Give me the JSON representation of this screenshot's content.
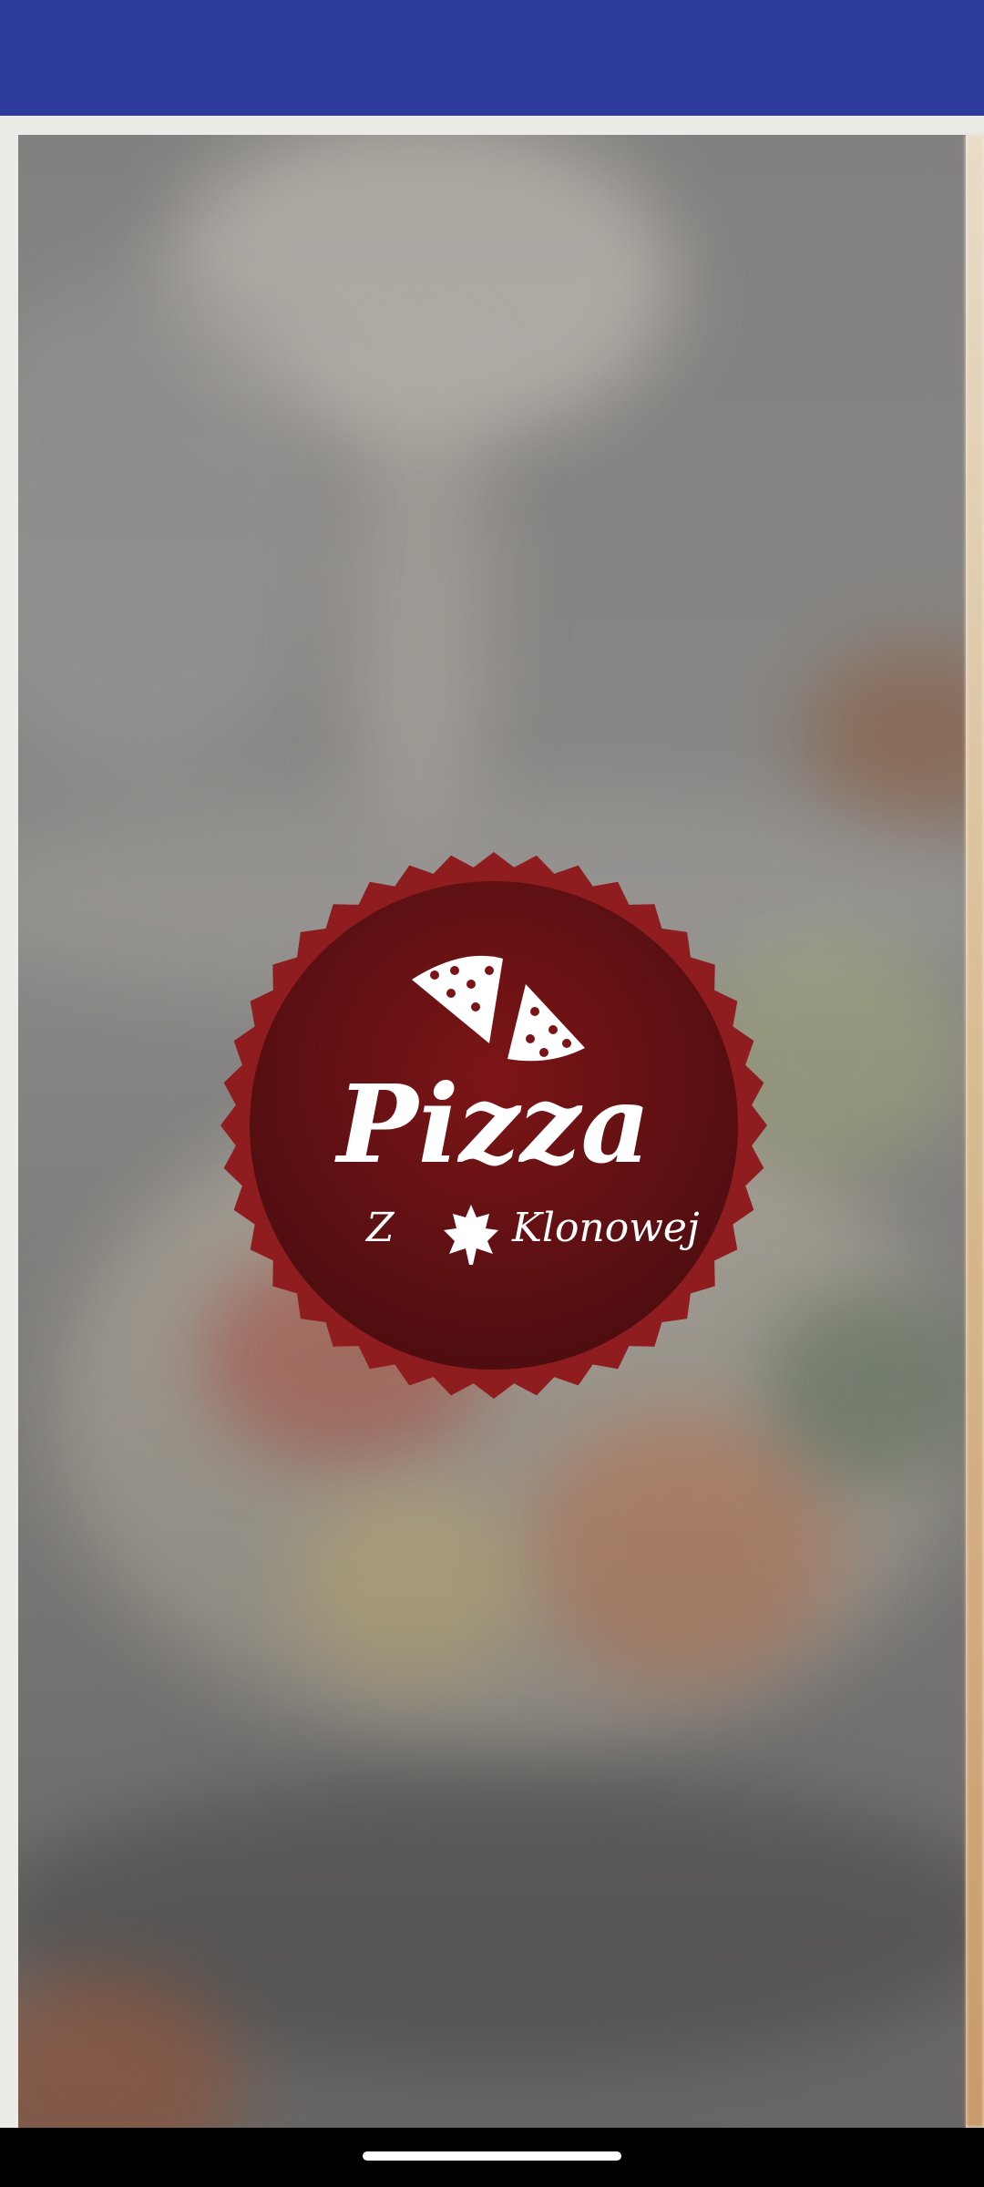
{
  "logo": {
    "title": "Pizza",
    "prefix": "Z",
    "suffix": "Klonowej",
    "leaf_icon": "maple-leaf-icon",
    "pizza_icon": "pizza-slices-icon",
    "badge_color": "#7a1417",
    "badge_edge_color": "#8f1c1f",
    "text_color": "#ffffff"
  },
  "colors": {
    "status_bar": "#2e3c9c",
    "nav_bar": "#000000",
    "home_indicator": "#ffffff"
  }
}
